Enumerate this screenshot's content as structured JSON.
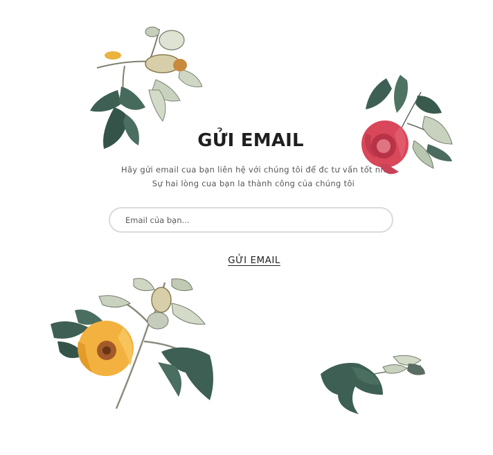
{
  "newsletter": {
    "title": "GỬI EMAIL",
    "description_line1": "Hãy gửi email cua bạn liên hệ với chúng tôi để đc tư vấn tốt nh",
    "description_line2": "Sự hai lòng cua bạn la thành công của chúng tôi",
    "email_placeholder": "Email của bạn...",
    "email_value": "",
    "submit_label": "GỬI EMAIL"
  },
  "decorations": [
    {
      "name": "cotton-branch-top-left-illustration"
    },
    {
      "name": "red-camellia-top-right-illustration"
    },
    {
      "name": "yellow-cotton-flower-bottom-left-illustration"
    },
    {
      "name": "leaf-sprig-bottom-right-illustration"
    }
  ],
  "colors": {
    "leaf_dark": "#3e5f53",
    "leaf_light": "#c9d2bf",
    "flower_red": "#d9475a",
    "flower_yellow": "#f3b13f",
    "stem": "#8a8d7c",
    "text": "#1f1f1f",
    "border": "#dadada"
  }
}
